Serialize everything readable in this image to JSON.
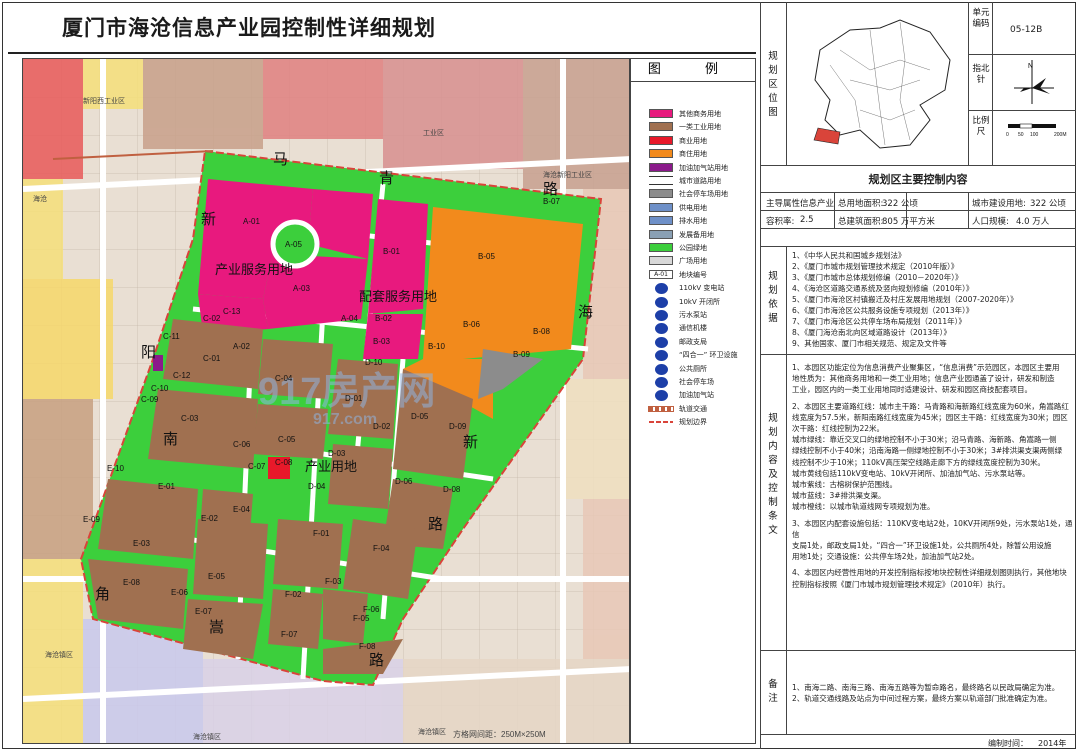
{
  "title": "厦门市海沧信息产业园控制性详细规划",
  "map": {
    "roads": {
      "north": [
        "马",
        "青",
        "路"
      ],
      "east": [
        "海",
        "新",
        "路"
      ],
      "west": [
        "新",
        "阳",
        "南"
      ],
      "south": [
        "角",
        "嵩",
        "路"
      ]
    },
    "district_labels": {
      "industrial_service": "产业服务用地",
      "supporting_service": "配套服务用地",
      "industrial": "产业用地"
    },
    "context_labels": {
      "nw": "新阳西工业区",
      "ne": "海沧新阳工业区",
      "w": "海沧",
      "n_mid": "工业区",
      "sw1": "海沧镇区",
      "s1": "海沧镇区",
      "s2": "海沧镇区"
    },
    "scale_note": "方格网间距：250M×250M",
    "watermark": "917房产网",
    "watermark_url": "917.com",
    "parcels": [
      {
        "id": "A-01",
        "cls": "pink"
      },
      {
        "id": "A-02",
        "cls": "pink"
      },
      {
        "id": "A-03",
        "cls": "pink"
      },
      {
        "id": "A-04",
        "cls": "green"
      },
      {
        "id": "A-05",
        "cls": "green"
      },
      {
        "id": "B-01",
        "cls": "pink"
      },
      {
        "id": "B-02",
        "cls": "pink"
      },
      {
        "id": "B-03",
        "cls": "pink"
      },
      {
        "id": "B-05",
        "cls": "orange"
      },
      {
        "id": "B-06",
        "cls": "orange"
      },
      {
        "id": "B-07",
        "cls": "green"
      },
      {
        "id": "B-08",
        "cls": "green"
      },
      {
        "id": "B-09",
        "cls": "gray"
      },
      {
        "id": "B-10",
        "cls": "green"
      },
      {
        "id": "C-01",
        "cls": "brown"
      },
      {
        "id": "C-02",
        "cls": "brown"
      },
      {
        "id": "C-03",
        "cls": "brown"
      },
      {
        "id": "C-04",
        "cls": "brown"
      },
      {
        "id": "C-05",
        "cls": "brown"
      },
      {
        "id": "C-06",
        "cls": "green"
      },
      {
        "id": "C-07",
        "cls": "brown"
      },
      {
        "id": "C-08",
        "cls": "red"
      },
      {
        "id": "C-09",
        "cls": "green"
      },
      {
        "id": "C-10",
        "cls": "green"
      },
      {
        "id": "C-11",
        "cls": "green"
      },
      {
        "id": "C-12",
        "cls": "purple"
      },
      {
        "id": "C-13",
        "cls": "green"
      },
      {
        "id": "D-01",
        "cls": "brown"
      },
      {
        "id": "D-02",
        "cls": "brown"
      },
      {
        "id": "D-03",
        "cls": "brown"
      },
      {
        "id": "D-04",
        "cls": "green"
      },
      {
        "id": "D-05",
        "cls": "brown"
      },
      {
        "id": "D-06",
        "cls": "brown"
      },
      {
        "id": "D-08",
        "cls": "green"
      },
      {
        "id": "D-09",
        "cls": "green"
      },
      {
        "id": "D-10",
        "cls": "green"
      },
      {
        "id": "E-01",
        "cls": "brown"
      },
      {
        "id": "E-02",
        "cls": "brown"
      },
      {
        "id": "E-03",
        "cls": "brown"
      },
      {
        "id": "E-04",
        "cls": "brown"
      },
      {
        "id": "E-05",
        "cls": "brown"
      },
      {
        "id": "E-06",
        "cls": "green"
      },
      {
        "id": "E-07",
        "cls": "green"
      },
      {
        "id": "E-08",
        "cls": "green"
      },
      {
        "id": "E-09",
        "cls": "green"
      },
      {
        "id": "E-10",
        "cls": "green"
      },
      {
        "id": "F-01",
        "cls": "brown"
      },
      {
        "id": "F-02",
        "cls": "brown"
      },
      {
        "id": "F-03",
        "cls": "brown"
      },
      {
        "id": "F-04",
        "cls": "brown"
      },
      {
        "id": "F-05",
        "cls": "brown"
      },
      {
        "id": "F-06",
        "cls": "brown"
      },
      {
        "id": "F-07",
        "cls": "green"
      },
      {
        "id": "F-08",
        "cls": "green"
      }
    ]
  },
  "legend": {
    "title": "图 例",
    "items": [
      {
        "label": "其他商务用地",
        "color": "#e8197e",
        "kind": "fill"
      },
      {
        "label": "一类工业用地",
        "color": "#a07050",
        "kind": "fill"
      },
      {
        "label": "商业用地",
        "color": "#e8192a",
        "kind": "fill"
      },
      {
        "label": "商住用地",
        "color": "#f28a1c",
        "kind": "fill"
      },
      {
        "label": "加油加气站用地",
        "color": "#8b1a8b",
        "kind": "fill"
      },
      {
        "label": "城市道路用地",
        "color": "#ffffff",
        "kind": "road"
      },
      {
        "label": "社会停车场用地",
        "color": "#8c8c8c",
        "kind": "fill"
      },
      {
        "label": "供电用地",
        "color": "#6e90c8",
        "kind": "fill"
      },
      {
        "label": "排水用地",
        "color": "#6e90c8",
        "kind": "fill"
      },
      {
        "label": "发展备用地",
        "color": "#8aa0b4",
        "kind": "fill"
      },
      {
        "label": "公园绿地",
        "color": "#3ccf3c",
        "kind": "fill"
      },
      {
        "label": "广场用地",
        "color": "#d8d8d8",
        "kind": "fill"
      },
      {
        "label": "地块编号",
        "code": "A-01",
        "kind": "code"
      },
      {
        "label": "110kV 变电站",
        "kind": "symbol",
        "sym": "110kV"
      },
      {
        "label": "10kV 开闭所",
        "kind": "symbol",
        "sym": "10kV"
      },
      {
        "label": "污水泵站",
        "kind": "symbol",
        "sym": "W"
      },
      {
        "label": "通信机楼",
        "kind": "symbol",
        "sym": "T"
      },
      {
        "label": "邮政支局",
        "kind": "symbol",
        "sym": "P"
      },
      {
        "label": "“四合一” 环卫设施",
        "kind": "symbol",
        "sym": "H"
      },
      {
        "label": "公共厕所",
        "kind": "symbol",
        "sym": "WC"
      },
      {
        "label": "社会停车场",
        "kind": "symbol",
        "sym": "P"
      },
      {
        "label": "加油加气站",
        "kind": "symbol",
        "sym": "G"
      },
      {
        "label": "轨道交通",
        "kind": "rail"
      },
      {
        "label": "规划边界",
        "kind": "boundary"
      }
    ]
  },
  "info": {
    "unit_code_label": "单元编码",
    "unit_code": "05-12B",
    "north_label": "指北针",
    "scale_label": "比例尺",
    "scale_ticks": [
      "0",
      "50",
      "100",
      "200M"
    ],
    "location_label": "规划区位图",
    "main_content_title": "规划区主要控制内容",
    "row1": {
      "attr_label": "主导属性:",
      "attr": "信息产业",
      "area_label": "总用地面积:",
      "area": "322 公顷",
      "build_label": "城市建设用地:",
      "build": "322 公顷"
    },
    "row2": {
      "far_label": "容积率:",
      "far": "2.5",
      "gfa_label": "总建筑面积:",
      "gfa": "805 万平方米",
      "pop_label": "人口规模:",
      "pop": "4.0 万人"
    },
    "basis_label": "规划依据",
    "basis_items": [
      "1、《中华人民共和国城乡规划法》",
      "2、《厦门市城市规划管理技术规定（2010年版）》",
      "3、《厦门市城市总体规划修编（2010－2020年）》",
      "4、《海沧区道路交通系统及竖向规划修编（2010年）》",
      "5、《厦门市海沧区村镇搬迁及村庄发展用地规划（2007-2020年）》",
      "6、《厦门市海沧区公共服务设施专项规划（2013年）》",
      "7、《厦门市海沧区公共停车场布局规划（2011年）》",
      "8、《厦门海沧南北向区域道路设计（2013年）》",
      "9、其他国家、厦门市相关规范、规定及文件等"
    ],
    "control_label": "规划内容及控制条文",
    "control_paras": [
      "1、本园区功能定位为信息消费产业聚集区，“信息消费”示范园区，本园区主要用",
      "地性质为：其他商务用地和一类工业用地；信息产业园通盖了设计，研发和制造",
      "工业，园区内的一类工业用地同时适建设计、研发和园区商技配套项目。",
      "",
      "2、本园区主要道路红线：城市主干路：马青路和海新路红线宽度为60米，角嵩路红",
      "线宽度为57.5米，新阳南路红线宽度为45米；园区主干路：红线宽度为30米；园区",
      "次干路：红线控制为22米。",
      "城市绿线：靠近交叉口的绿地控制不小于30米；沿马青路、海新路、角嵩路一侧",
      "绿线控制不小于40米；沿南海路一侧绿地控制不小于30米；3#排洪渠支渠两侧绿",
      "线控制不少于10米；110kV高压架空线路走廊下方的绿线宽度控制为30米。",
      "城市黄线包括110kV变电站、10kV开闭所、加油加气站、污水泵站等。",
      "城市紫线：古榕树保护范围线。",
      "城市蓝线：3#排洪渠支渠。",
      "城市橙线：以城市轨道线网专项规划为准。",
      "",
      "3、本园区内配套设施包括：110KV变电站2处，10KV开闭所9处，污水泵站1处，通信",
      "支局1处，邮政支局1处，“四合一”环卫设施1处，公共厕所4处，除暂公用设施",
      "用地1处；交通设施：公共停车场2处，加油加气站2处。",
      "",
      "4、本园区内经营性用地的开发控制指标按地块控制性详细规划图则执行，其他地块",
      "控制指标按照《厦门市城市规划管理技术规定》（2010年）执行。"
    ],
    "note_label": "备注",
    "notes": [
      "1、南海二路、南海三路、南海五路等为暂命路名，最终路名以民政局确定为准。",
      "2、轨道交通线路及站点为中间过程方案，最终方案以轨道部门批准确定为准。"
    ],
    "date_label": "编制时间：",
    "date": "2014年"
  }
}
